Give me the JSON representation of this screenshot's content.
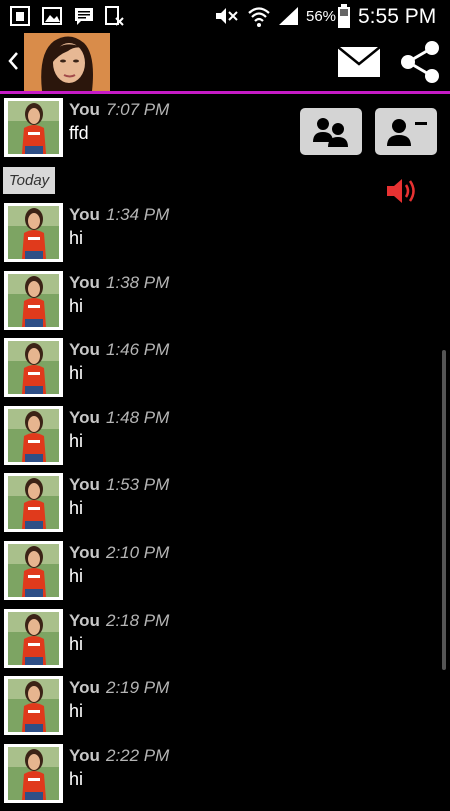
{
  "status_bar": {
    "battery_percent": "56%",
    "time": "5:55 PM",
    "icons": [
      "notification-icon",
      "gallery-icon",
      "message-icon",
      "blocked-icon",
      "mute-icon",
      "wifi-icon",
      "signal-icon",
      "battery-icon"
    ]
  },
  "header": {
    "back_icon": "chevron-left-icon",
    "mail_icon": "mail-icon",
    "share_icon": "share-icon",
    "accent_color": "#c61bc6"
  },
  "conversation": {
    "first_message": {
      "sender": "You",
      "time": "7:07 PM",
      "text": "ffd"
    },
    "date_separator": "Today",
    "messages": [
      {
        "sender": "You",
        "time": "1:34 PM",
        "text": "hi"
      },
      {
        "sender": "You",
        "time": "1:38 PM",
        "text": "hi"
      },
      {
        "sender": "You",
        "time": "1:46 PM",
        "text": "hi"
      },
      {
        "sender": "You",
        "time": "1:48 PM",
        "text": "hi"
      },
      {
        "sender": "You",
        "time": "1:53 PM",
        "text": "hi"
      },
      {
        "sender": "You",
        "time": "2:10 PM",
        "text": "hi"
      },
      {
        "sender": "You",
        "time": "2:18 PM",
        "text": "hi"
      },
      {
        "sender": "You",
        "time": "2:19 PM",
        "text": "hi"
      },
      {
        "sender": "You",
        "time": "2:22 PM",
        "text": "hi"
      }
    ]
  },
  "controls": {
    "group_contacts_icon": "group-contacts-icon",
    "remove_contact_icon": "remove-contact-icon",
    "speaker_icon": "speaker-icon",
    "speaker_color": "#e83232"
  }
}
